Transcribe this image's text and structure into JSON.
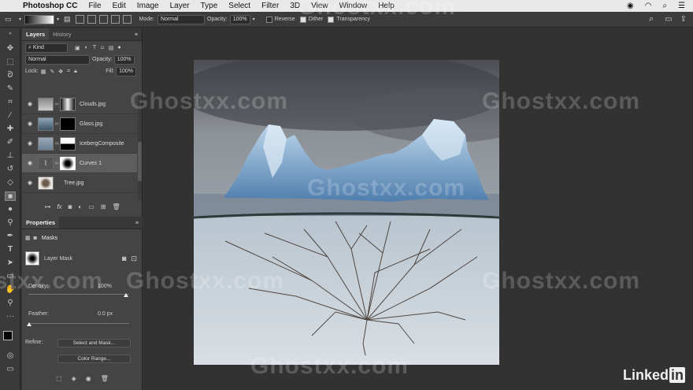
{
  "menubar": {
    "app": "Photoshop CC",
    "items": [
      "File",
      "Edit",
      "Image",
      "Layer",
      "Type",
      "Select",
      "Filter",
      "3D",
      "View",
      "Window",
      "Help"
    ]
  },
  "options": {
    "mode_label": "Mode:",
    "mode_value": "Normal",
    "opacity_label": "Opacity:",
    "opacity_value": "100%",
    "reverse": "Reverse",
    "dither": "Dither",
    "transparency": "Transparency"
  },
  "layers_panel": {
    "tabs": [
      "Layers",
      "History"
    ],
    "filter_kind": "Kind",
    "blend_mode": "Normal",
    "opacity_label": "Opacity:",
    "opacity_value": "100%",
    "lock_label": "Lock:",
    "fill_label": "Fill:",
    "fill_value": "100%",
    "layers": [
      {
        "name": "Clouds.jpg"
      },
      {
        "name": "Glass.jpg"
      },
      {
        "name": "IcebergComposite"
      },
      {
        "name": "Curves 1"
      },
      {
        "name": "Tree.jpg"
      }
    ]
  },
  "properties_panel": {
    "title": "Properties",
    "section": "Masks",
    "mask_type": "Layer Mask",
    "density_label": "Density:",
    "density_value": "100%",
    "feather_label": "Feather:",
    "feather_value": "0.0 px",
    "refine_label": "Refine:",
    "select_and_mask": "Select and Mask...",
    "color_range": "Color Range..."
  },
  "watermark": "Ghostxx.com",
  "brand": {
    "linked": "Linked",
    "in": "in"
  }
}
